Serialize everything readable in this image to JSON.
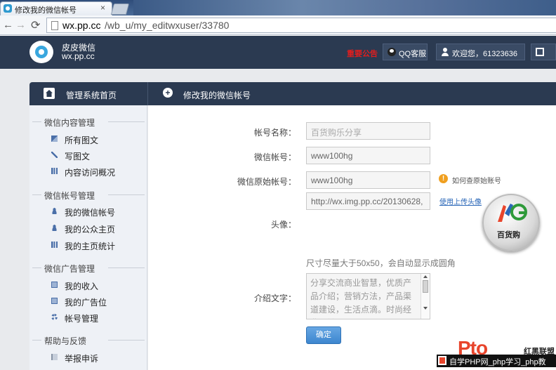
{
  "browser": {
    "tab_title": "修改我的微信帐号",
    "tab_close": "×",
    "url_host": "wx.pp.cc",
    "url_path": "/wb_u/my_editwxuser/33780",
    "back": "←",
    "forward": "→",
    "reload": "⟳"
  },
  "header": {
    "logo_name": "皮皮微信",
    "logo_domain": "wx.pp.cc",
    "notice": "重要公告",
    "qq_service": "QQ客服",
    "welcome": "欢迎您，61323636"
  },
  "breadcrumb": {
    "home": "管理系统首页",
    "current": "修改我的微信帐号"
  },
  "sidebar": {
    "groups": [
      {
        "title": "微信内容管理",
        "items": [
          "所有图文",
          "写图文",
          "内容访问概况"
        ]
      },
      {
        "title": "微信帐号管理",
        "items": [
          "我的微信帐号",
          "我的公众主页",
          "我的主页统计"
        ]
      },
      {
        "title": "微信广告管理",
        "items": [
          "我的收入",
          "我的广告位",
          "帐号管理"
        ]
      },
      {
        "title": "帮助与反馈",
        "items": [
          "举报申诉"
        ]
      }
    ]
  },
  "form": {
    "account_name_label": "帐号名称：",
    "account_name_placeholder": "百货购乐分享",
    "wechat_id_label": "微信帐号：",
    "wechat_id_value": "www100hg",
    "original_id_label": "微信原始帐号：",
    "original_id_value": "www100hg",
    "help_link": "如何查原始账号",
    "avatar_label": "头像：",
    "avatar_url_value": "http://wx.img.pp.cc/20130628,",
    "upload_link": "使用上传头像",
    "avatar_brand": "百货购",
    "size_hint": "尺寸尽量大于50x50，会自动显示成圆角",
    "intro_label": "介绍文字：",
    "intro_value": "分享交流商业智慧，优质产品介绍；营销方法，产品渠道建设，生活点滴。时尚经典、健",
    "submit": "确定"
  },
  "watermark": {
    "brand": "红黑联盟",
    "strip": "自学PHP网_php学习_php教"
  },
  "colors": {
    "header_bg": "#2b3a51",
    "sidebar_bg": "#eef1f6",
    "button_blue": "#3d86cf",
    "notice_red": "#e01e1e"
  }
}
